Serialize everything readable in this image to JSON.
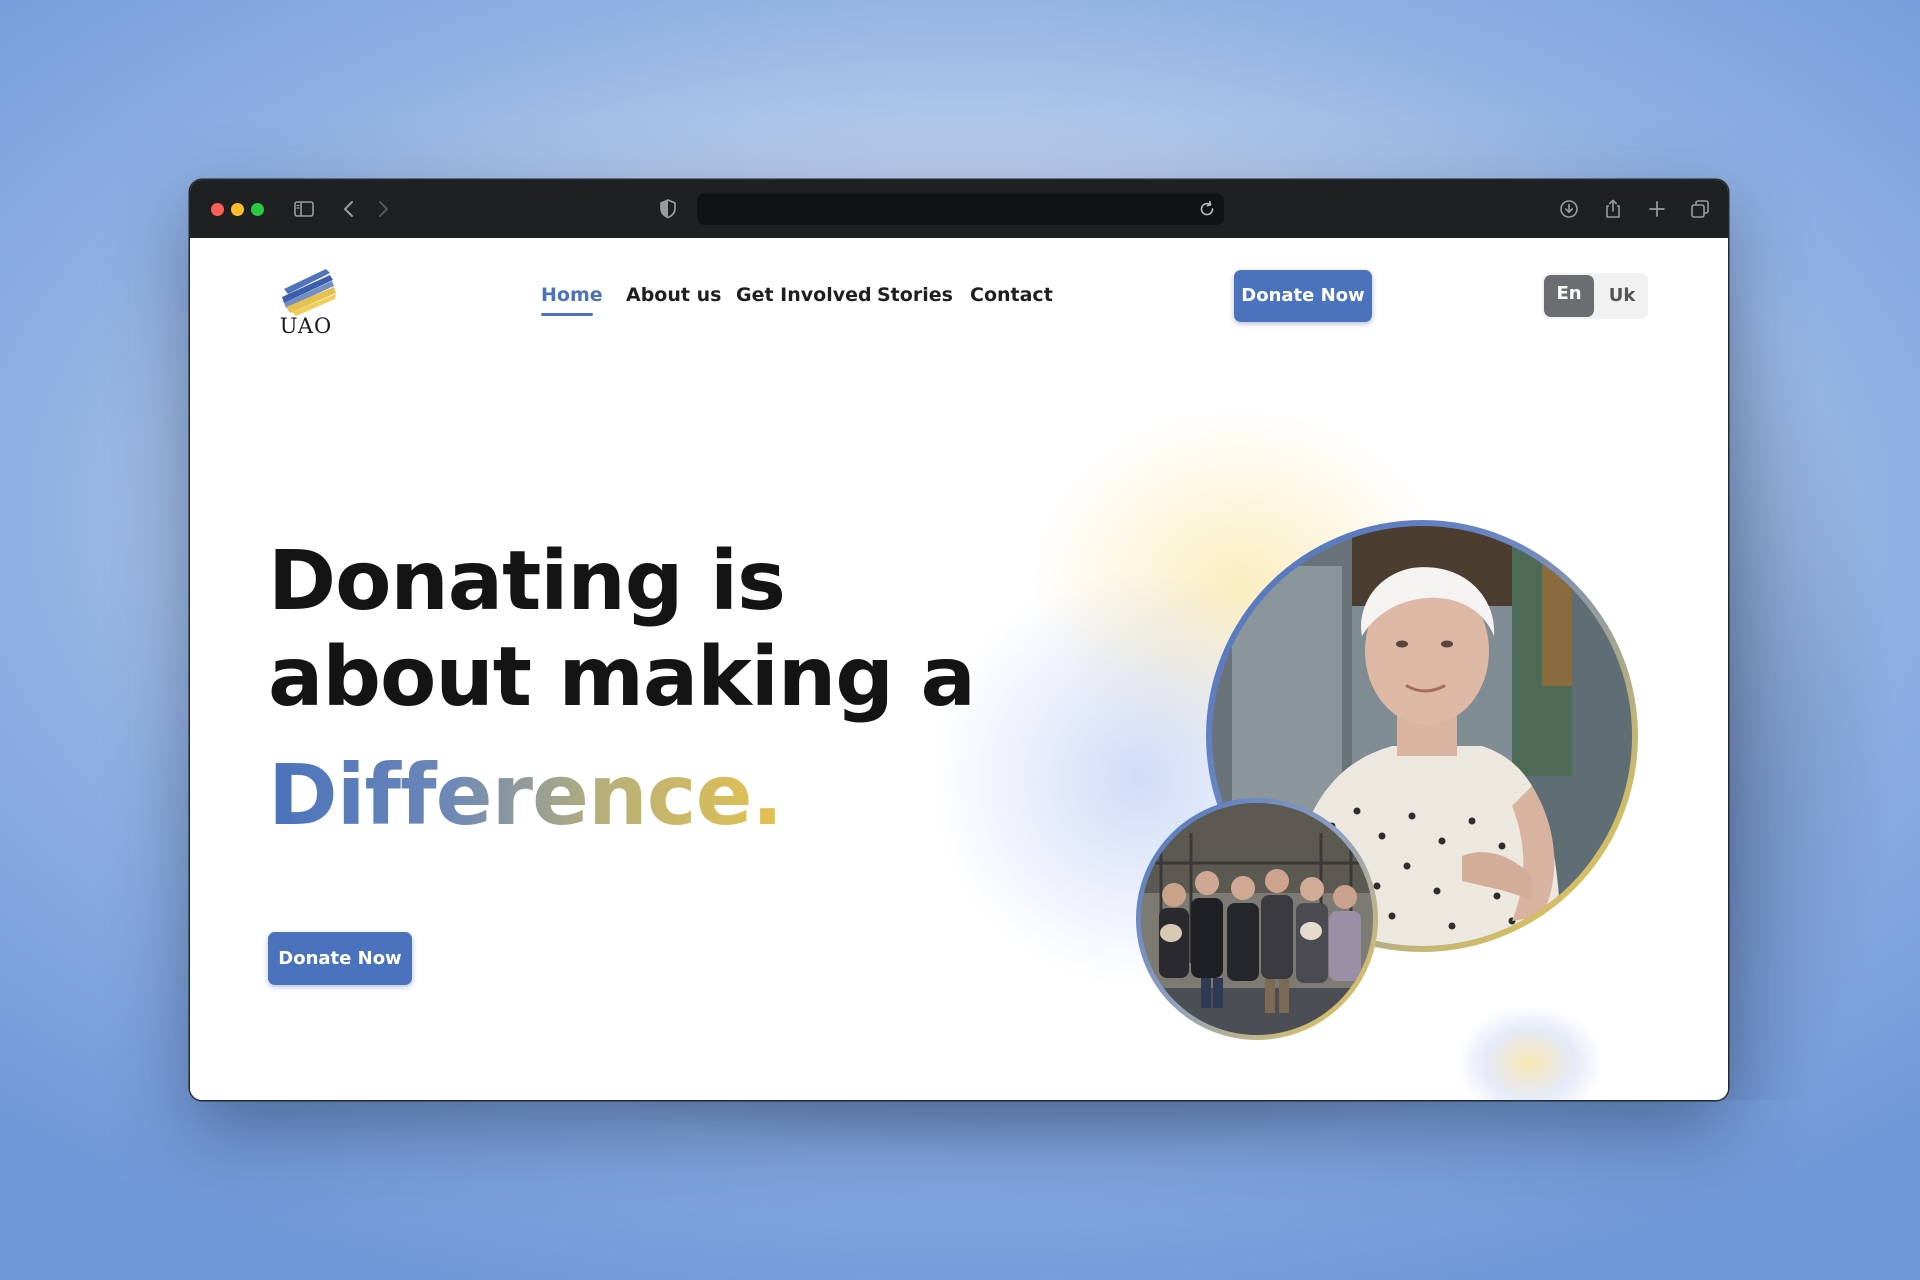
{
  "brand": {
    "logo_text": "UAO"
  },
  "nav": {
    "items": [
      {
        "label": "Home",
        "active": true
      },
      {
        "label": "About us"
      },
      {
        "label": "Get Involved"
      },
      {
        "label": "Stories"
      },
      {
        "label": "Contact"
      }
    ],
    "cta_label": "Donate Now"
  },
  "language": {
    "options": [
      "En",
      "Uk"
    ],
    "selected": "En"
  },
  "hero": {
    "line1": "Donating is",
    "line2": "about making a",
    "highlight": "Difference.",
    "cta_label": "Donate Now"
  },
  "colors": {
    "accent_blue": "#4a72bd",
    "accent_yellow": "#f0c94a",
    "text_dark": "#141414"
  },
  "icons": {
    "titlebar": [
      "sidebar-icon",
      "back-icon",
      "forward-icon",
      "shield-icon",
      "reload-icon",
      "download-icon",
      "share-icon",
      "new-tab-icon",
      "tabs-overview-icon"
    ]
  }
}
